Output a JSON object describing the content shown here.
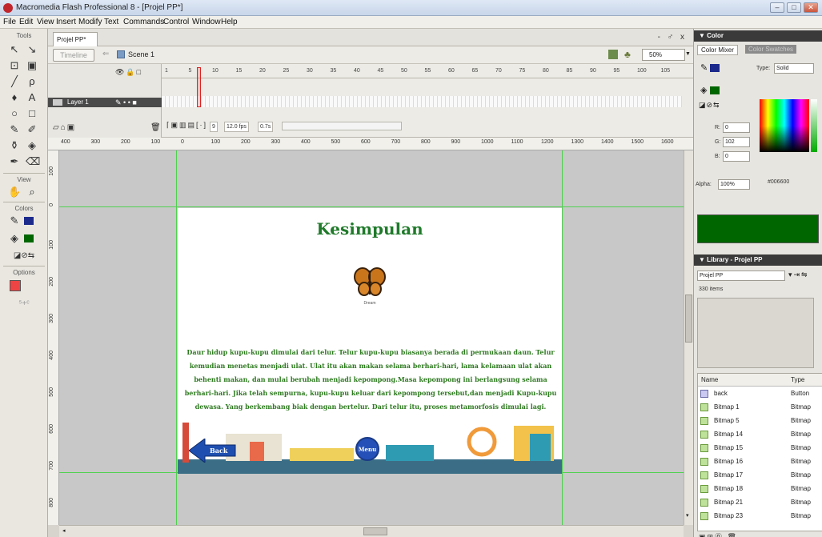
{
  "window": {
    "title": "Macromedia Flash Professional 8 - [Projel PP*]",
    "buttons": [
      "–",
      "□",
      "✕"
    ]
  },
  "menu": [
    "File",
    "Edit",
    "View",
    "Insert",
    "Modify",
    "Text",
    "Commands",
    "Control",
    "Window",
    "Help"
  ],
  "tools": {
    "header": "Tools",
    "view_label": "View",
    "colors_label": "Colors",
    "options_label": "Options"
  },
  "document": {
    "tab": "Projel PP*",
    "window_controls": "- ♂ x",
    "timeline_button": "Timeline",
    "scene": "Scene 1",
    "zoom": "50%"
  },
  "timeline": {
    "layer": "Layer 1",
    "frame_numbers": [
      "1",
      "5",
      "10",
      "15",
      "20",
      "25",
      "30",
      "35",
      "40",
      "45",
      "50",
      "55",
      "60",
      "65",
      "70",
      "75",
      "80",
      "85",
      "90",
      "95",
      "100",
      "105"
    ],
    "current_frame": "9",
    "fps": "12.0 fps",
    "elapsed": "0.7s"
  },
  "rulers": {
    "horizontal": [
      "400",
      "300",
      "200",
      "100",
      "0",
      "100",
      "200",
      "300",
      "400",
      "500",
      "600",
      "700",
      "800",
      "900",
      "1000",
      "1100",
      "1200",
      "1300",
      "1400",
      "1500",
      "1600"
    ],
    "vertical": [
      "100",
      "0",
      "100",
      "200",
      "300",
      "400",
      "500",
      "600",
      "700",
      "800"
    ]
  },
  "stage": {
    "title": "Kesimpulan",
    "butterfly_caption": "Dream",
    "body": "Daur hidup kupu-kupu dimulai dari telur. Telur kupu-kupu biasanya berada di permukaan daun. Telur kemudian menetas menjadi ulat. Ulat itu akan makan selama berhari-hari, lama kelamaan ulat akan behenti makan, dan mulai berubah  menjadi kepompong.Masa kepompong ini berlangsung selama berhari-hari. Jika telah sempurna, kupu-kupu keluar dari kepompong tersebut,dan menjadi Kupu-kupu dewasa. Yang berkembang biak dengan bertelur. Dari telur itu,  proses metamorfosis dimulai lagi.",
    "back_button": "Back",
    "menu_button": "Menu"
  },
  "color_panel": {
    "header": "▼ Color",
    "tab_mixer": "Color Mixer",
    "tab_swatches": "Color Swatches",
    "type_label": "Type:",
    "type_value": "Solid",
    "r_label": "R:",
    "r_value": "0",
    "g_label": "G:",
    "g_value": "102",
    "b_label": "B:",
    "b_value": "0",
    "alpha_label": "Alpha:",
    "alpha_value": "100%",
    "hex": "#006600",
    "fill_color": "#006600"
  },
  "library_panel": {
    "header": "▼ Library - Projel PP",
    "document": "Projel PP",
    "count": "330 items",
    "col_name": "Name",
    "col_type": "Type",
    "items": [
      {
        "name": "back",
        "type": "Button"
      },
      {
        "name": "Bitmap 1",
        "type": "Bitmap"
      },
      {
        "name": "Bitmap 5",
        "type": "Bitmap"
      },
      {
        "name": "Bitmap 14",
        "type": "Bitmap"
      },
      {
        "name": "Bitmap 15",
        "type": "Bitmap"
      },
      {
        "name": "Bitmap 16",
        "type": "Bitmap"
      },
      {
        "name": "Bitmap 17",
        "type": "Bitmap"
      },
      {
        "name": "Bitmap 18",
        "type": "Bitmap"
      },
      {
        "name": "Bitmap 21",
        "type": "Bitmap"
      },
      {
        "name": "Bitmap 23",
        "type": "Bitmap"
      }
    ]
  }
}
